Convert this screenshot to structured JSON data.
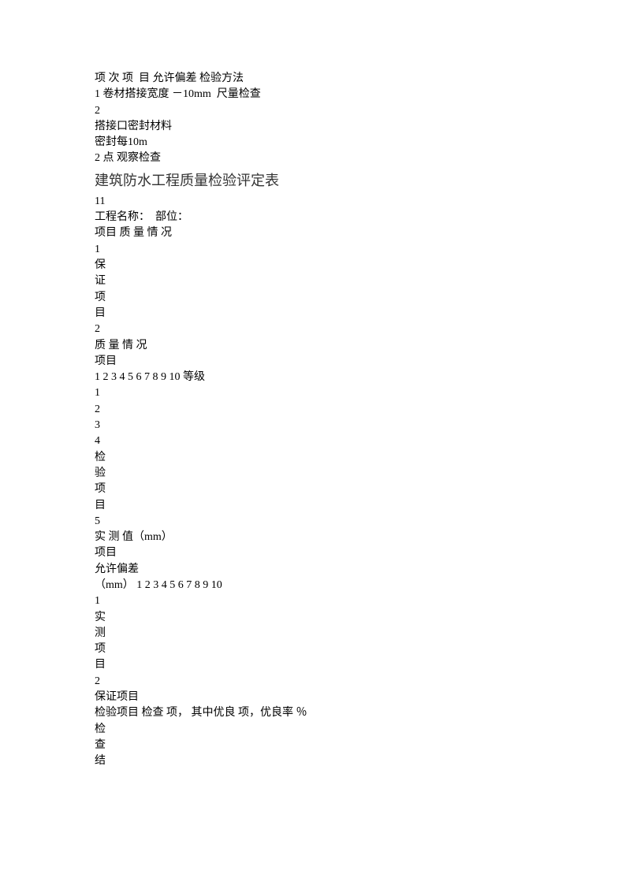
{
  "header": {
    "col_labels": "项 次 项  目 允许偏差 检验方法",
    "row1": "1 卷材搭接宽度 －10mm  尺量检查",
    "row2_num": "2",
    "row2_item": "搭接口密封材料",
    "row2_detail": "密封每10m",
    "row2_method": "2 点 观察检查"
  },
  "title": "建筑防水工程质量检验评定表",
  "section": {
    "num11": "11",
    "proj_label": "工程名称：  部位：",
    "item_label": "项目 质 量 情 况",
    "n1": "1",
    "v_bao": "保",
    "v_zheng": "证",
    "v_xiang": "项",
    "v_mu": "目",
    "n2": "2",
    "quality": "质 量 情 况",
    "item_only": "项目",
    "rank_seq": "1 2 3 4 5 6 7 8 9 10 等级",
    "n1b": "1",
    "n2b": "2",
    "n3": "3",
    "n4": "4",
    "v_jian": "检",
    "v_yan": "验",
    "v_xiang2": "项",
    "v_mu2": "目",
    "n5": "5",
    "measured": "实 测 值（mm）",
    "item_only2": "项目",
    "allowed": "允许偏差",
    "mm_seq": "（mm） 1 2 3 4 5 6 7 8 9 10",
    "n1c": "1",
    "v_shi": "实",
    "v_ce": "测",
    "v_xiang3": "项",
    "v_mu3": "目",
    "n2c": "2",
    "guarantee": "保证项目",
    "inspect_line": "检验项目 检查 项， 其中优良 项，优良率 ％",
    "v_jian2": "检",
    "v_cha": "查",
    "v_jie": "结"
  }
}
